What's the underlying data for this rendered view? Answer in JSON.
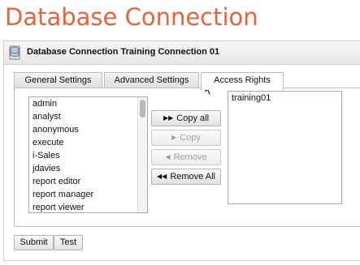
{
  "page": {
    "title": "Database Connection"
  },
  "panel": {
    "title": "Database Connection Training Connection 01",
    "icon": "database-icon"
  },
  "tabs": [
    {
      "label": "General Settings",
      "active": false
    },
    {
      "label": "Advanced Settings",
      "active": false
    },
    {
      "label": "Access Rights",
      "active": true
    }
  ],
  "available_users": [
    "admin",
    "analyst",
    "anonymous",
    "execute",
    "i-Sales",
    "jdavies",
    "report editor",
    "report manager",
    "report viewer"
  ],
  "assigned_users": [
    "training01"
  ],
  "actions": {
    "copy_all": {
      "label": "Copy all",
      "icon": "double-right-arrow-icon",
      "enabled": true
    },
    "copy": {
      "label": "Copy",
      "icon": "right-arrow-icon",
      "enabled": false
    },
    "remove": {
      "label": "Remove",
      "icon": "left-arrow-icon",
      "enabled": false
    },
    "remove_all": {
      "label": "Remove All",
      "icon": "double-left-arrow-icon",
      "enabled": true
    }
  },
  "footer": {
    "submit_label": "Submit",
    "test_label": "Test"
  },
  "colors": {
    "title": "#e8623a"
  }
}
